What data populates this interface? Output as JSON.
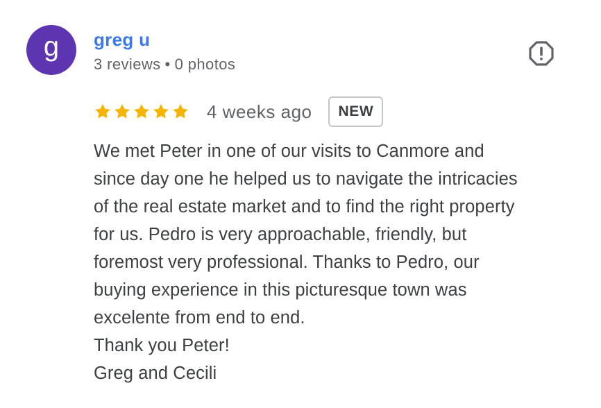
{
  "review": {
    "author": {
      "initial": "g",
      "name": "greg u",
      "reviews_count": "3 reviews",
      "separator": "•",
      "photos_count": "0 photos",
      "avatar_color": "#5e35b1"
    },
    "rating": {
      "stars": 5,
      "max_stars": 5,
      "star_color": "#f4b400"
    },
    "date": "4 weeks ago",
    "badge": "NEW",
    "flag_icon": "flag-report-icon",
    "text_lines": [
      "We met Peter in one of our visits to Canmore and",
      "since day one he helped us to navigate the intricacies",
      "of the real estate market and to find the right property",
      "for us. Pedro is very approachable, friendly, but",
      "foremost very professional. Thanks to Pedro, our",
      "buying experience in this picturesque town was",
      "excelente from end to end.",
      "Thank you Peter!",
      "Greg and Cecili"
    ]
  }
}
